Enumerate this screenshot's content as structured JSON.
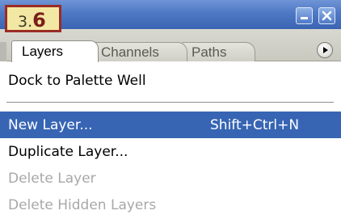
{
  "step_badge": {
    "prefix": "3.",
    "number": "6"
  },
  "tabs": [
    {
      "label": "Layers",
      "active": true
    },
    {
      "label": "Channels",
      "active": false
    },
    {
      "label": "Paths",
      "active": false
    }
  ],
  "menu": {
    "dock_label": "Dock to Palette Well",
    "items": [
      {
        "label": "New Layer...",
        "shortcut": "Shift+Ctrl+N",
        "state": "selected"
      },
      {
        "label": "Duplicate Layer...",
        "shortcut": "",
        "state": "enabled"
      },
      {
        "label": "Delete Layer",
        "shortcut": "",
        "state": "disabled"
      },
      {
        "label": "Delete Hidden Layers",
        "shortcut": "",
        "state": "disabled"
      }
    ]
  },
  "colors": {
    "title_bar": "#4e78c4",
    "selection": "#3765b4",
    "badge_bg": "#f2e8a4",
    "badge_border": "#9b2b25",
    "disabled_text": "#a8a8a8"
  },
  "icons": [
    "minimize-icon",
    "close-icon",
    "palette-menu-arrow-icon"
  ]
}
